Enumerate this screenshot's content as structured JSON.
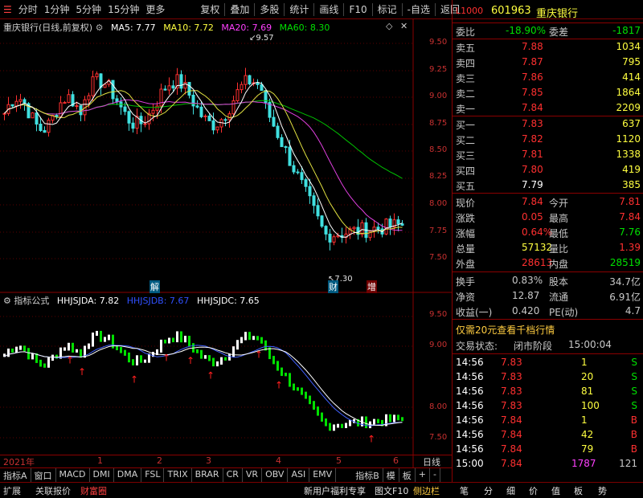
{
  "toolbar": {
    "items": [
      "分时",
      "1分钟",
      "5分钟",
      "15分钟",
      "更多",
      "复权",
      "叠加",
      "多股",
      "统计",
      "画线",
      "F10",
      "标记",
      "-自选",
      "返回"
    ]
  },
  "chart_header": {
    "stock": "重庆银行(日线,前复权)",
    "ma5": "MA5: 7.77",
    "ma10": "MA10: 7.72",
    "ma20": "MA20: 7.69",
    "ma60": "MA60: 8.30"
  },
  "price_axis": [
    "9.50",
    "9.25",
    "9.00",
    "8.75",
    "8.50",
    "8.25",
    "8.00",
    "7.75",
    "7.50"
  ],
  "annotations": {
    "high": "9.57",
    "low": "7.30",
    "jie": "解",
    "cai": "财",
    "zeng": "增"
  },
  "indicator_header": {
    "name": "指标公式",
    "a": "HHJSJDA: 7.82",
    "b": "HHJSJDB: 7.67",
    "c": "HHJSJDC: 7.65"
  },
  "ind_axis": [
    "9.50",
    "9.00",
    "8.00",
    "7.50"
  ],
  "time_axis": {
    "year": "2021年",
    "months": [
      "1",
      "2",
      "3",
      "4",
      "5",
      "6"
    ],
    "period": "日线"
  },
  "tabs": [
    "指标A",
    "窗口",
    "MACD",
    "DMI",
    "DMA",
    "FSL",
    "TRIX",
    "BRAR",
    "CR",
    "VR",
    "OBV",
    "ASI",
    "EMV",
    "指标B",
    "模",
    "板",
    "+",
    "-"
  ],
  "bottom_tabs": [
    "扩展",
    "关联报价",
    "财富圈"
  ],
  "bottom_right": {
    "promo": "新用户福利专享",
    "f10": "图文F10",
    "side": "侧边栏",
    "icons": [
      "笔",
      "分",
      "细",
      "价",
      "值",
      "板",
      "势"
    ]
  },
  "quote": {
    "code": "601963",
    "name": "重庆银行",
    "logo": "L1000",
    "weibi_label": "委比",
    "weibi": "-18.90%",
    "weicha_label": "委差",
    "weicha": "-1817",
    "sells": [
      {
        "label": "卖五",
        "price": "7.88",
        "vol": "1034"
      },
      {
        "label": "卖四",
        "price": "7.87",
        "vol": "795"
      },
      {
        "label": "卖三",
        "price": "7.86",
        "vol": "414"
      },
      {
        "label": "卖二",
        "price": "7.85",
        "vol": "1864"
      },
      {
        "label": "卖一",
        "price": "7.84",
        "vol": "2209"
      }
    ],
    "buys": [
      {
        "label": "买一",
        "price": "7.83",
        "vol": "637"
      },
      {
        "label": "买二",
        "price": "7.82",
        "vol": "1120"
      },
      {
        "label": "买三",
        "price": "7.81",
        "vol": "1338"
      },
      {
        "label": "买四",
        "price": "7.80",
        "vol": "419"
      },
      {
        "label": "买五",
        "price": "7.79",
        "vol": "385"
      }
    ],
    "stats": [
      {
        "l1": "现价",
        "v1": "7.84",
        "l2": "今开",
        "v2": "7.81"
      },
      {
        "l1": "涨跌",
        "v1": "0.05",
        "l2": "最高",
        "v2": "7.84"
      },
      {
        "l1": "涨幅",
        "v1": "0.64%",
        "l2": "最低",
        "v2": "7.76"
      },
      {
        "l1": "总量",
        "v1": "57132",
        "l2": "量比",
        "v2": "1.39"
      },
      {
        "l1": "外盘",
        "v1": "28613",
        "l2": "内盘",
        "v2": "28519"
      }
    ],
    "fund": [
      {
        "l1": "换手",
        "v1": "0.83%",
        "l2": "股本",
        "v2": "34.7亿"
      },
      {
        "l1": "净资",
        "v1": "12.87",
        "l2": "流通",
        "v2": "6.91亿"
      },
      {
        "l1": "收益(一)",
        "v1": "0.420",
        "l2": "PE(动)",
        "v2": "4.7"
      }
    ],
    "promo": "仅需20元查看千档行情",
    "status_label": "交易状态:",
    "status": "闭市阶段",
    "status_time": "15:00:04",
    "ticks": [
      {
        "t": "14:56",
        "p": "7.83",
        "v": "1",
        "s": "S"
      },
      {
        "t": "14:56",
        "p": "7.83",
        "v": "20",
        "s": "S"
      },
      {
        "t": "14:56",
        "p": "7.83",
        "v": "81",
        "s": "S"
      },
      {
        "t": "14:56",
        "p": "7.83",
        "v": "100",
        "s": "S"
      },
      {
        "t": "14:56",
        "p": "7.84",
        "v": "1",
        "s": "B"
      },
      {
        "t": "14:56",
        "p": "7.84",
        "v": "42",
        "s": "B"
      },
      {
        "t": "14:56",
        "p": "7.84",
        "v": "79",
        "s": "B"
      },
      {
        "t": "15:00",
        "p": "7.84",
        "v": "1787",
        "s": "121"
      }
    ]
  }
}
